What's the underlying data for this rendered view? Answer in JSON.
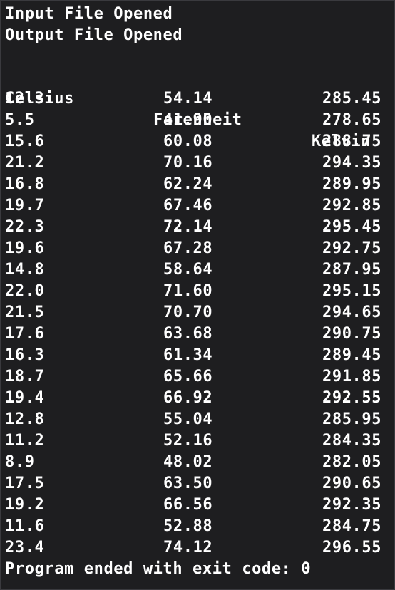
{
  "console": {
    "messages": [
      "Input File Opened",
      "Output File Opened"
    ],
    "headers": {
      "celsius": "Celsius",
      "fahrenheit": "Farenheit",
      "kelvin": "Kelvin"
    },
    "rows": [
      [
        "12.3",
        "54.14",
        "285.45"
      ],
      [
        "5.5",
        "41.90",
        "278.65"
      ],
      [
        "15.6",
        "60.08",
        "288.75"
      ],
      [
        "21.2",
        "70.16",
        "294.35"
      ],
      [
        "16.8",
        "62.24",
        "289.95"
      ],
      [
        "19.7",
        "67.46",
        "292.85"
      ],
      [
        "22.3",
        "72.14",
        "295.45"
      ],
      [
        "19.6",
        "67.28",
        "292.75"
      ],
      [
        "14.8",
        "58.64",
        "287.95"
      ],
      [
        "22.0",
        "71.60",
        "295.15"
      ],
      [
        "21.5",
        "70.70",
        "294.65"
      ],
      [
        "17.6",
        "63.68",
        "290.75"
      ],
      [
        "16.3",
        "61.34",
        "289.45"
      ],
      [
        "18.7",
        "65.66",
        "291.85"
      ],
      [
        "19.4",
        "66.92",
        "292.55"
      ],
      [
        "12.8",
        "55.04",
        "285.95"
      ],
      [
        "11.2",
        "52.16",
        "284.35"
      ],
      [
        "8.9",
        "48.02",
        "282.05"
      ],
      [
        "17.5",
        "63.50",
        "290.65"
      ],
      [
        "19.2",
        "66.56",
        "292.35"
      ],
      [
        "11.6",
        "52.88",
        "284.75"
      ],
      [
        "23.4",
        "74.12",
        "296.55"
      ]
    ],
    "exit_message": "Program ended with exit code: 0"
  }
}
